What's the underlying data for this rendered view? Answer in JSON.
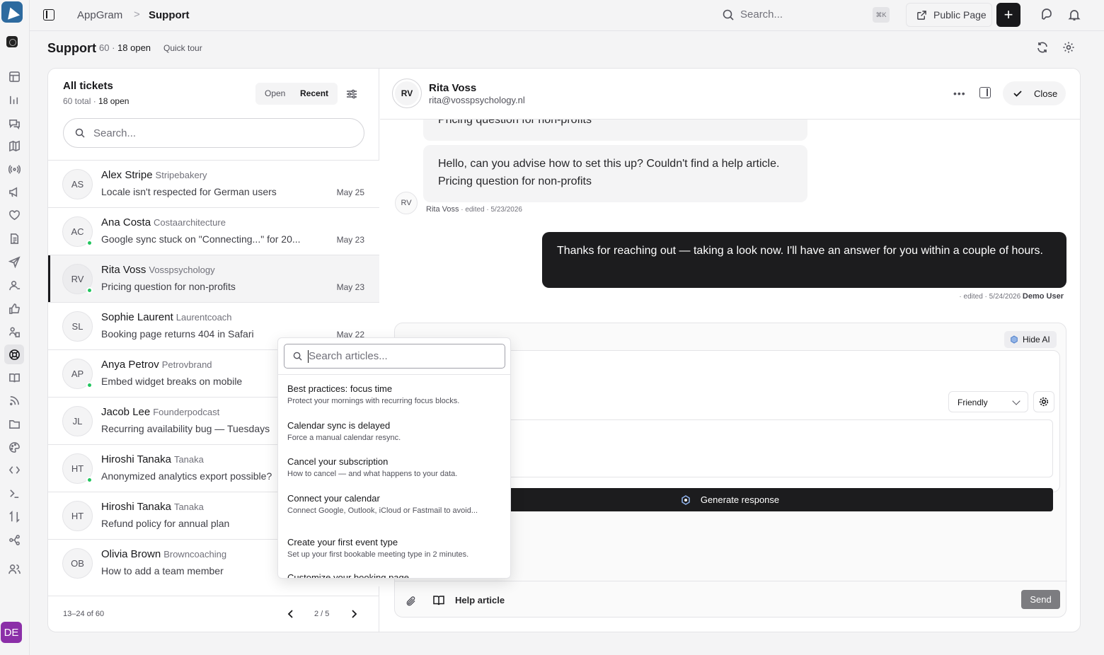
{
  "app": {
    "user_initials": "DE",
    "accent": "#18181b"
  },
  "topbar": {
    "breadcrumb_app": "AppGram",
    "breadcrumb_sep": ">",
    "breadcrumb_page": "Support",
    "search_placeholder": "Search...",
    "search_shortcut": "⌘K",
    "public_page_label": "Public Page",
    "new_button_label": "+"
  },
  "page": {
    "title": "Support",
    "total": "60",
    "open_count": "18 open",
    "quick_tour": "Quick tour"
  },
  "ticket_list": {
    "title": "All tickets",
    "total_label": "60 total ·",
    "open_label": "18 open",
    "filter_open": "Open",
    "filter_recent": "Recent",
    "search_placeholder": "Search...",
    "tickets": [
      {
        "initials": "AS",
        "name": "Alex Stripe",
        "company": "Stripebakery",
        "subject": "Locale isn't respected for German users",
        "date": "May 25",
        "online": false,
        "selected": false
      },
      {
        "initials": "AC",
        "name": "Ana Costa",
        "company": "Costaarchitecture",
        "subject": "Google sync stuck on \"Connecting...\" for 20...",
        "date": "May 23",
        "online": true,
        "selected": false
      },
      {
        "initials": "RV",
        "name": "Rita Voss",
        "company": "Vosspsychology",
        "subject": "Pricing question for non-profits",
        "date": "May 23",
        "online": true,
        "selected": true
      },
      {
        "initials": "SL",
        "name": "Sophie Laurent",
        "company": "Laurentcoach",
        "subject": "Booking page returns 404 in Safari",
        "date": "May 22",
        "online": false,
        "selected": false
      },
      {
        "initials": "AP",
        "name": "Anya Petrov",
        "company": "Petrovbrand",
        "subject": "Embed widget breaks on mobile",
        "date": "",
        "online": true,
        "selected": false
      },
      {
        "initials": "JL",
        "name": "Jacob Lee",
        "company": "Founderpodcast",
        "subject": "Recurring availability bug — Tuesdays",
        "date": "",
        "online": false,
        "selected": false
      },
      {
        "initials": "HT",
        "name": "Hiroshi Tanaka",
        "company": "Tanaka",
        "subject": "Anonymized analytics export possible?",
        "date": "",
        "online": true,
        "selected": false
      },
      {
        "initials": "HT",
        "name": "Hiroshi Tanaka",
        "company": "Tanaka",
        "subject": "Refund policy for annual plan",
        "date": "",
        "online": false,
        "selected": false
      },
      {
        "initials": "OB",
        "name": "Olivia Brown",
        "company": "Browncoaching",
        "subject": "How to add a team member",
        "date": "",
        "online": false,
        "selected": false
      }
    ],
    "footer_range": "13–24 of 60",
    "footer_page": "2 / 5"
  },
  "conversation": {
    "contact_initials": "RV",
    "contact_name": "Rita Voss",
    "contact_email": "rita@vosspsychology.nl",
    "more_label": "•••",
    "close_label": "Close",
    "messages": {
      "partial_text": "Pricing question for non-profits",
      "incoming_text_1": "Hello, can you advise how to set this up? Couldn't find a help article.",
      "incoming_text_2": "Pricing question for non-profits",
      "incoming_initials": "RV",
      "incoming_author": "Rita Voss",
      "incoming_meta": "· edited · 5/23/2026",
      "outgoing_text": "Thanks for reaching out — taking a look now. I'll have an answer for you within a couple of hours.",
      "outgoing_meta": "· edited · 5/24/2026",
      "outgoing_author": "Demo User"
    }
  },
  "composer": {
    "hide_ai_label": "Hide AI",
    "tone_value": "Friendly",
    "generate_label": "Generate response",
    "help_article_label": "Help article",
    "send_label": "Send"
  },
  "article_picker": {
    "search_placeholder": "Search articles...",
    "articles": [
      {
        "title": "Best practices: focus time",
        "desc": "Protect your mornings with recurring focus blocks."
      },
      {
        "title": "Calendar sync is delayed",
        "desc": "Force a manual calendar resync."
      },
      {
        "title": "Cancel your subscription",
        "desc": "How to cancel — and what happens to your data."
      },
      {
        "title": "Connect your calendar",
        "desc": "Connect Google, Outlook, iCloud or Fastmail to avoid..."
      },
      {
        "title": "Create your first event type",
        "desc": "Set up your first bookable meeting type in 2 minutes."
      },
      {
        "title": "Customize your booking page",
        "desc": ""
      }
    ]
  }
}
